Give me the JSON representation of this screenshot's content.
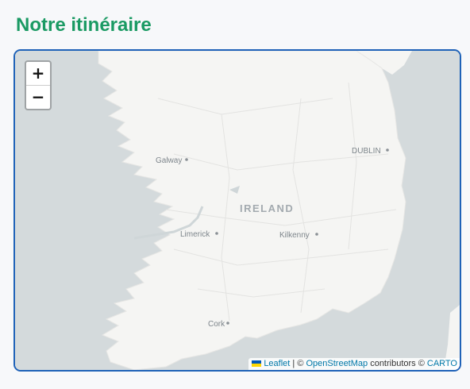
{
  "title": "Notre itinéraire",
  "map": {
    "zoom_in": "+",
    "zoom_out": "−",
    "country_label": "IRELAND",
    "cities": {
      "galway": "Galway",
      "dublin": "DUBLIN",
      "limerick": "Limerick",
      "kilkenny": "Kilkenny",
      "cork": "Cork"
    },
    "attribution": {
      "leaflet": "Leaflet",
      "sep": " | © ",
      "osm": "OpenStreetMap",
      "contrib": " contributors © ",
      "carto": "CARTO"
    },
    "colors": {
      "sea": "#d4dadc",
      "land": "#f5f5f3",
      "title": "#1a9a63",
      "border": "#1f62b8"
    }
  }
}
